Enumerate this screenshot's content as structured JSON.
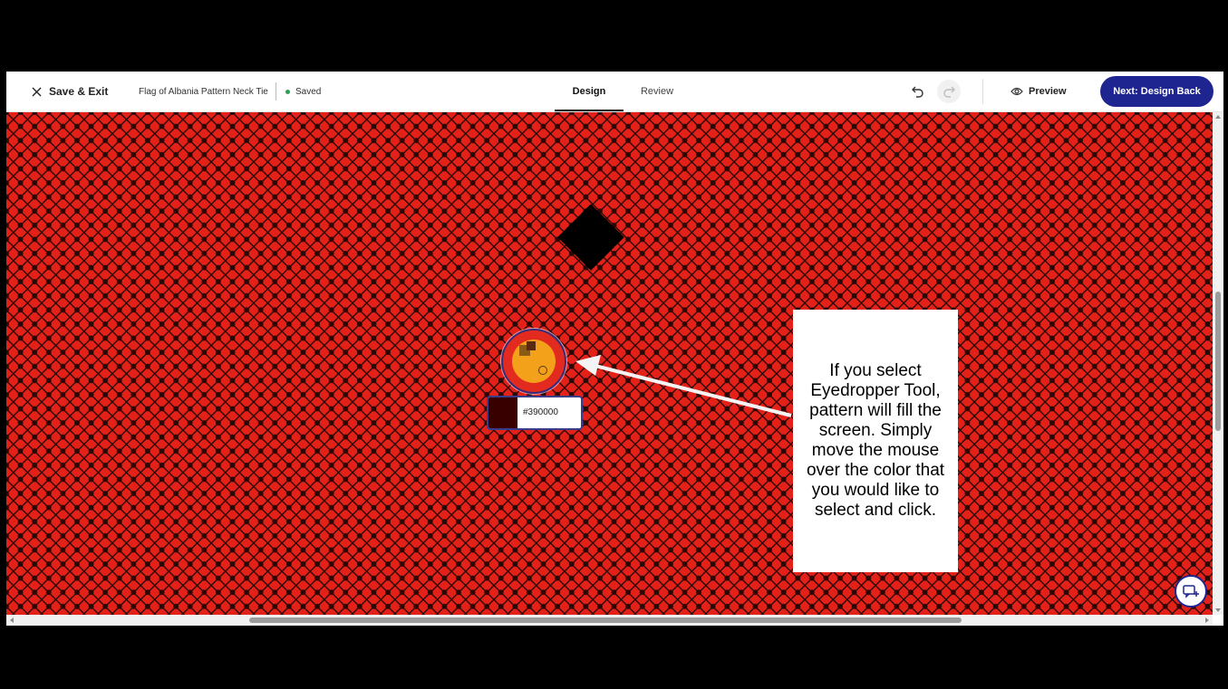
{
  "topbar": {
    "exit_label": "Save & Exit",
    "doc_title": "Flag of Albania Pattern Neck Tie",
    "status": "Saved",
    "tabs": [
      {
        "label": "Design",
        "active": true
      },
      {
        "label": "Review",
        "active": false
      }
    ],
    "preview_label": "Preview",
    "next_label": "Next: Design Back"
  },
  "eyedropper": {
    "hex_value": "#390000",
    "swatch_color": "#390000"
  },
  "callout": {
    "text": "If you select Eyedropper Tool, pattern will fill the screen. Simply move the mouse over the color that you would like to select and click."
  },
  "icons": {
    "close": "close-icon",
    "undo": "undo-icon",
    "redo": "redo-icon",
    "preview": "eye-icon",
    "feedback": "feedback-icon"
  },
  "colors": {
    "pattern_red": "#e32119",
    "pattern_dark": "#2a0806",
    "primary_button": "#1e2590",
    "saved_dot": "#2f9e55"
  }
}
